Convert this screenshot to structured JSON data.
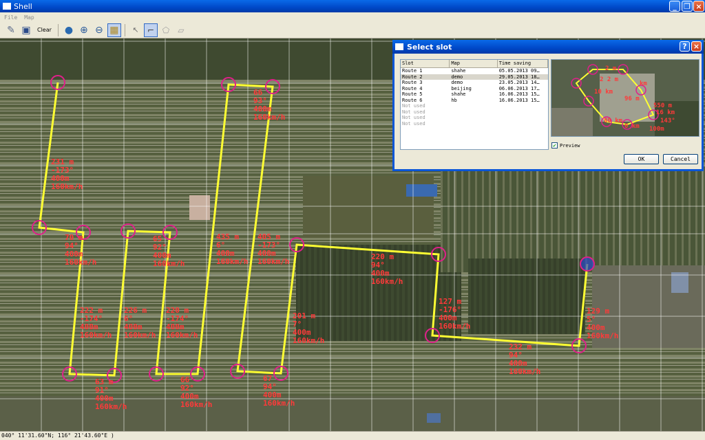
{
  "window": {
    "title": "Shell"
  },
  "menu": {
    "file": "File",
    "map": "Map"
  },
  "toolbar": {
    "clear_label": "Clear"
  },
  "status": {
    "coords": "040° 11'31.60\"N; 116° 21'43.60\"E )"
  },
  "map": {
    "labels": [
      {
        "id": "l1",
        "lines": [
          "231 m",
          "-173°",
          "400m",
          "160km/h"
        ]
      },
      {
        "id": "l2",
        "lines": [
          "66",
          "93°",
          "400m",
          "160km/h"
        ]
      },
      {
        "id": "l3",
        "lines": [
          "70 m",
          "94°",
          "400m",
          "160km/h"
        ]
      },
      {
        "id": "l4",
        "lines": [
          "65",
          "92°",
          "400m",
          "160km/h"
        ]
      },
      {
        "id": "l5",
        "lines": [
          "435 m",
          "6°",
          "400m",
          "160km/h"
        ]
      },
      {
        "id": "l6",
        "lines": [
          "405 m",
          "-173°",
          "400m",
          "160km/h"
        ]
      },
      {
        "id": "l7",
        "lines": [
          "220 m",
          "94°",
          "400m",
          "160km/h"
        ]
      },
      {
        "id": "l8",
        "lines": [
          "222 m",
          "-174°",
          "400m",
          "160km/h"
        ]
      },
      {
        "id": "l9",
        "lines": [
          "226 m",
          "6°",
          "400m",
          "160km/h"
        ]
      },
      {
        "id": "l10",
        "lines": [
          "220 m",
          "-174°",
          "400m",
          "160km/h"
        ]
      },
      {
        "id": "l11",
        "lines": [
          "201 m",
          "7°",
          "400m",
          "160km/h"
        ]
      },
      {
        "id": "l12",
        "lines": [
          "127 m",
          "-176°",
          "400m",
          "160km/h"
        ]
      },
      {
        "id": "l13",
        "lines": [
          "129 m",
          "5°",
          "400m",
          "160km/h"
        ]
      },
      {
        "id": "l14",
        "lines": [
          "232 m",
          "94°",
          "400m",
          "160km/h"
        ]
      },
      {
        "id": "l15",
        "lines": [
          "63 m",
          "91°",
          "400m",
          "160km/h"
        ]
      },
      {
        "id": "l16",
        "lines": [
          "66",
          "92°",
          "400m",
          "160km/h"
        ]
      },
      {
        "id": "l17",
        "lines": [
          "67",
          "94°",
          "400m",
          "160km/h"
        ]
      }
    ]
  },
  "dialog": {
    "title": "Select slot",
    "columns": [
      "Slot",
      "Map",
      "Time saving"
    ],
    "rows": [
      {
        "slot": "Route 1",
        "map": "shahe",
        "time": "05.05.2013 09…"
      },
      {
        "slot": "Route 2",
        "map": "demo",
        "time": "29.05.2013 18…"
      },
      {
        "slot": "Route 3",
        "map": "demo",
        "time": "23.05.2013 14…"
      },
      {
        "slot": "Route 4",
        "map": "beijing",
        "time": "06.06.2013 17…"
      },
      {
        "slot": "Route 5",
        "map": "shahe",
        "time": "16.06.2013 15…"
      },
      {
        "slot": "Route 6",
        "map": "hb",
        "time": "16.06.2013 15…"
      },
      {
        "slot": "Not used",
        "map": "",
        "time": ""
      },
      {
        "slot": "Not used",
        "map": "",
        "time": ""
      },
      {
        "slot": "Not used",
        "map": "",
        "time": ""
      },
      {
        "slot": "Not used",
        "map": "",
        "time": ""
      }
    ],
    "preview_labels": [
      "2 m",
      "km",
      "2 2 m",
      "96 m",
      "10 km",
      "550 m",
      "16 km",
      "143°",
      "100m",
      "0 km",
      "80 km"
    ],
    "preview_checkbox": "Preview",
    "ok_label": "OK",
    "cancel_label": "Cancel",
    "help_label": "?",
    "close_label": "×"
  }
}
